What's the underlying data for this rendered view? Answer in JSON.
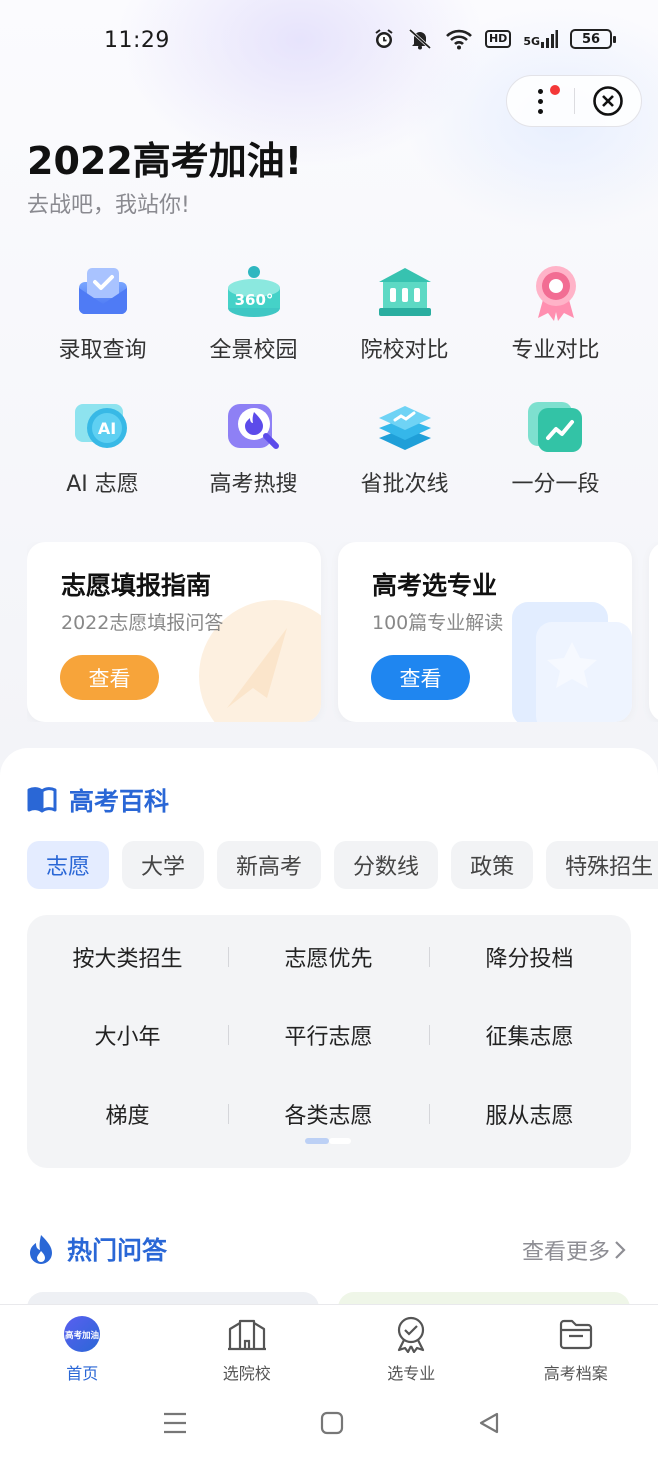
{
  "status_bar": {
    "time": "11:29",
    "battery": "56",
    "hd": "HD",
    "network": "5G"
  },
  "header": {
    "title": "2022高考加油!",
    "subtitle": "去战吧，我站你!"
  },
  "quick_grid": [
    {
      "label": "录取查询",
      "icon": "envelope-check-icon"
    },
    {
      "label": "全景校园",
      "icon": "panorama-360-icon"
    },
    {
      "label": "院校对比",
      "icon": "university-building-icon"
    },
    {
      "label": "专业对比",
      "icon": "award-ribbon-icon"
    },
    {
      "label": "AI 志愿",
      "icon": "ai-chat-icon"
    },
    {
      "label": "高考热搜",
      "icon": "hot-search-icon"
    },
    {
      "label": "省批次线",
      "icon": "stacked-chart-icon"
    },
    {
      "label": "一分一段",
      "icon": "score-trend-icon"
    }
  ],
  "cards": [
    {
      "title": "志愿填报指南",
      "subtitle": "2022志愿填报问答",
      "button": "查看",
      "color": "#f7a43a"
    },
    {
      "title": "高考选专业",
      "subtitle": "100篇专业解读",
      "button": "查看",
      "color": "#1f86f0"
    }
  ],
  "encyclopedia": {
    "title": "高考百科",
    "tabs": [
      "志愿",
      "大学",
      "新高考",
      "分数线",
      "政策",
      "特殊招生"
    ],
    "active_tab": "志愿",
    "terms": [
      [
        "按大类招生",
        "志愿优先",
        "降分投档"
      ],
      [
        "大小年",
        "平行志愿",
        "征集志愿"
      ],
      [
        "梯度",
        "各类志愿",
        "服从志愿"
      ]
    ]
  },
  "hot_qa": {
    "title": "热门问答",
    "more": "查看更多"
  },
  "tab_bar": [
    {
      "label": "首页",
      "icon": "home-logo-icon",
      "logo_text": "高考加油"
    },
    {
      "label": "选院校",
      "icon": "school-building-icon"
    },
    {
      "label": "选专业",
      "icon": "major-badge-icon"
    },
    {
      "label": "高考档案",
      "icon": "folder-archive-icon"
    }
  ],
  "colors": {
    "accent": "#2a67d6",
    "orange": "#f7a43a",
    "blue_button": "#1f86f0"
  }
}
